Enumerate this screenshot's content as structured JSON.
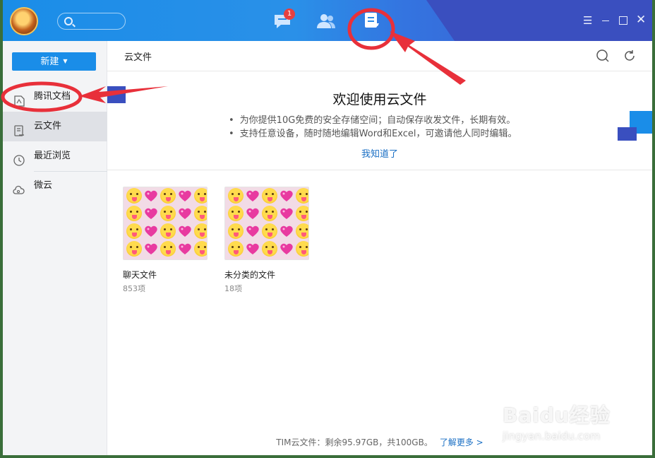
{
  "titlebar": {
    "notification_badge": "1",
    "icons": [
      "avatar",
      "search-icon",
      "messages-icon",
      "contacts-icon",
      "documents-icon",
      "menu-icon",
      "minimize-icon",
      "maximize-icon",
      "close-icon"
    ]
  },
  "sidebar": {
    "new_button": "新建",
    "items": [
      {
        "label": "腾讯文档",
        "icon": "tencent-docs-icon"
      },
      {
        "label": "云文件",
        "icon": "cloud-file-icon"
      },
      {
        "label": "最近浏览",
        "icon": "clock-icon"
      },
      {
        "label": "微云",
        "icon": "weiyun-icon"
      }
    ],
    "active_item": "云文件"
  },
  "main": {
    "breadcrumb": "云文件",
    "welcome_title": "欢迎使用云文件",
    "bullets": [
      "为你提供10G免费的安全存储空间；自动保存收发文件，长期有效。",
      "支持任意设备，随时随地编辑Word和Excel，可邀请他人同时编辑。"
    ],
    "got_it": "我知道了",
    "folders": [
      {
        "name": "聊天文件",
        "count": "853项"
      },
      {
        "name": "未分类的文件",
        "count": "18项"
      }
    ],
    "footer_text": "TIM云文件：剩余95.97GB，共100GB。",
    "footer_link": "了解更多 >"
  },
  "watermark": {
    "brand": "Baidu经验",
    "url": "jingyan.baidu.com"
  },
  "colors": {
    "accent": "#1a8de8",
    "annotation": "#e8303a",
    "deco_square": "#3a4fbf"
  }
}
